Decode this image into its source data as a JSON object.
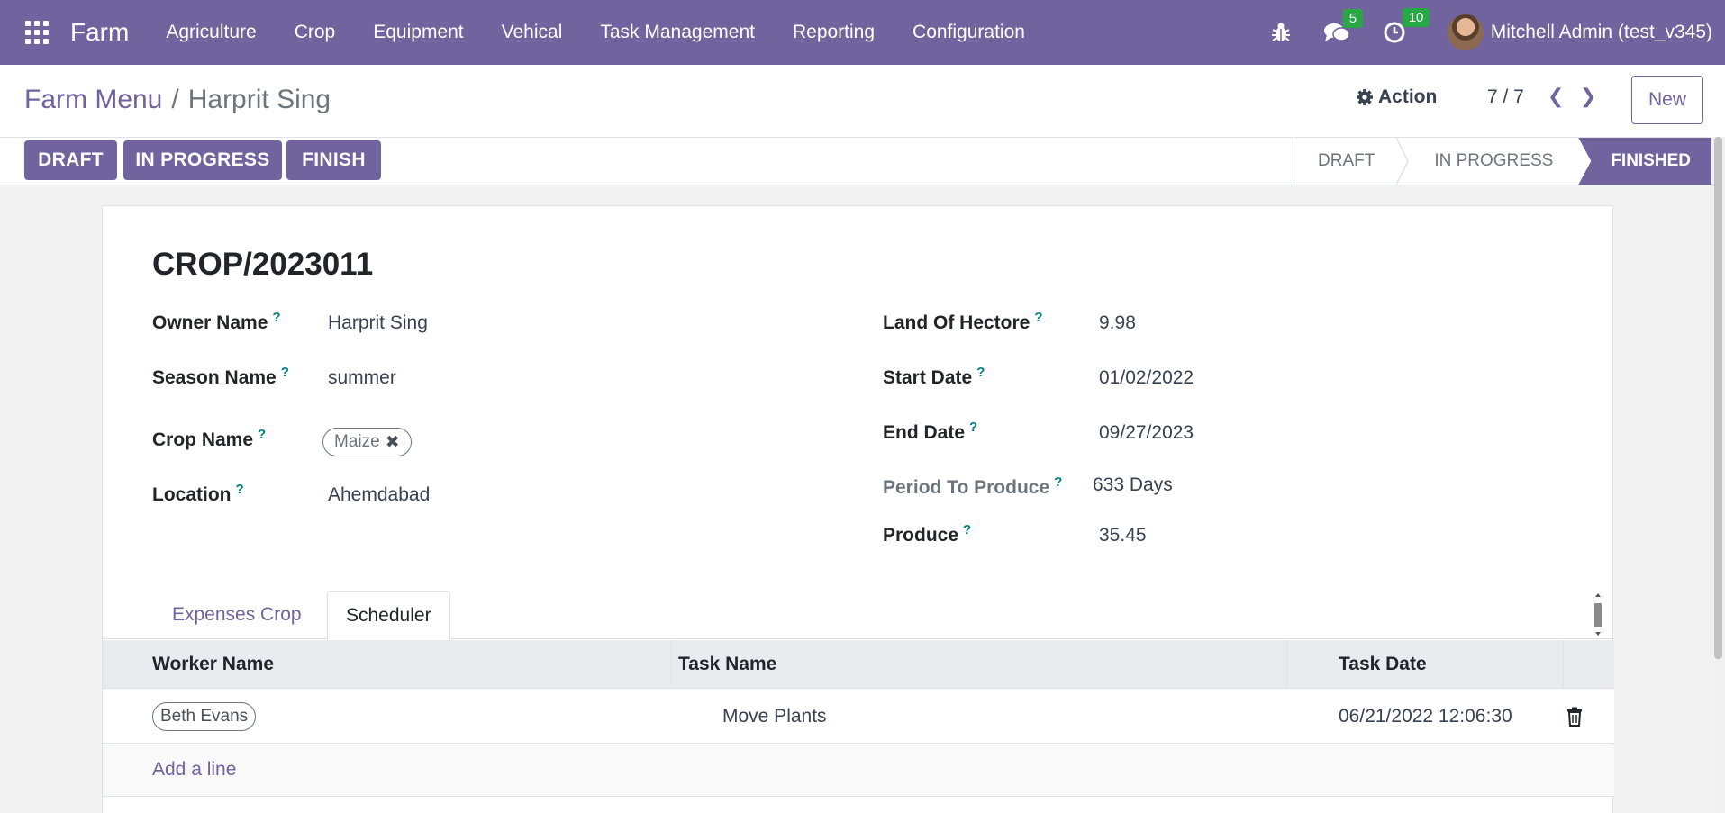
{
  "navbar": {
    "brand": "Farm",
    "menu": [
      "Agriculture",
      "Crop",
      "Equipment",
      "Vehical",
      "Task Management",
      "Reporting",
      "Configuration"
    ],
    "messages_badge": "5",
    "activities_badge": "10",
    "user_name": "Mitchell Admin (test_v345)"
  },
  "control": {
    "breadcrumb_parent": "Farm Menu",
    "breadcrumb_current": "Harprit Sing",
    "action_label": "Action",
    "pager": "7 / 7",
    "new_label": "New"
  },
  "status_buttons": [
    "DRAFT",
    "IN PROGRESS",
    "FINISH"
  ],
  "stages": [
    "DRAFT",
    "IN PROGRESS",
    "FINISHED"
  ],
  "active_stage": "FINISHED",
  "form": {
    "title": "CROP/2023011",
    "owner_label": "Owner Name",
    "owner_value": "Harprit Sing",
    "season_label": "Season Name",
    "season_value": "summer",
    "crop_label": "Crop Name",
    "crop_tag": "Maize",
    "location_label": "Location",
    "location_value": "Ahemdabad",
    "land_label": "Land Of Hectore",
    "land_value": "9.98",
    "start_label": "Start Date",
    "start_value": "01/02/2022",
    "end_label": "End Date",
    "end_value": "09/27/2023",
    "period_label": "Period To Produce",
    "period_value": "633 Days",
    "produce_label": "Produce",
    "produce_value": "35.45",
    "help_mark": "?"
  },
  "tabs": [
    "Expenses Crop",
    "Scheduler"
  ],
  "active_tab": "Scheduler",
  "table": {
    "headers": [
      "Worker Name",
      "Task Name",
      "Task Date"
    ],
    "rows": [
      {
        "worker": "Beth Evans",
        "task": "Move Plants",
        "date": "06/21/2022 12:06:30"
      }
    ],
    "add_line": "Add a line"
  },
  "colors": {
    "brand": "#71639e",
    "badge": "#28a745",
    "help": "#017e84"
  }
}
